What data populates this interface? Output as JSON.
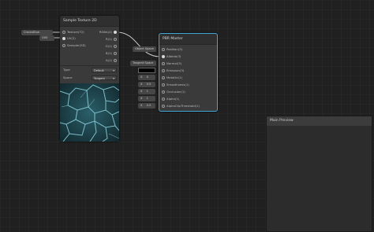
{
  "sample_node": {
    "title": "Sample Texture 2D",
    "inputs": [
      "Texture(T2)",
      "UV(2)",
      "Sampler(SS)"
    ],
    "outputs": [
      "RGBA(4)",
      "R(1)",
      "G(1)",
      "B(1)",
      "A(1)"
    ],
    "type_label": "Type",
    "type_value": "Default",
    "space_label": "Space",
    "space_value": "Tangent"
  },
  "texture_chip": {
    "label": "CracksBlue",
    "channel": "UV0"
  },
  "pbr_node": {
    "title": "PBR Master",
    "inputs": [
      "Position(3)",
      "Albedo(3)",
      "Normal(3)",
      "Emission(3)",
      "Metallic(1)",
      "Smoothness(1)",
      "Occlusion(1)",
      "Alpha(1)",
      "AlphaClipThreshold(1)"
    ]
  },
  "pbr_chips": {
    "object_space": "Object Space",
    "tangent_space": "Tangent Space",
    "metallic": {
      "axis": "X",
      "value": "0"
    },
    "smoothness": {
      "axis": "X",
      "value": "0.5"
    },
    "occlusion": {
      "axis": "X",
      "value": "1"
    },
    "alpha": {
      "axis": "X",
      "value": "1"
    },
    "alpha_clip": {
      "axis": "X",
      "value": "0.5"
    }
  },
  "main_preview": {
    "title": "Main Preview"
  },
  "colors": {
    "accent": "#3fa9d6",
    "background": "#202020",
    "node": "#3a3a3a"
  }
}
